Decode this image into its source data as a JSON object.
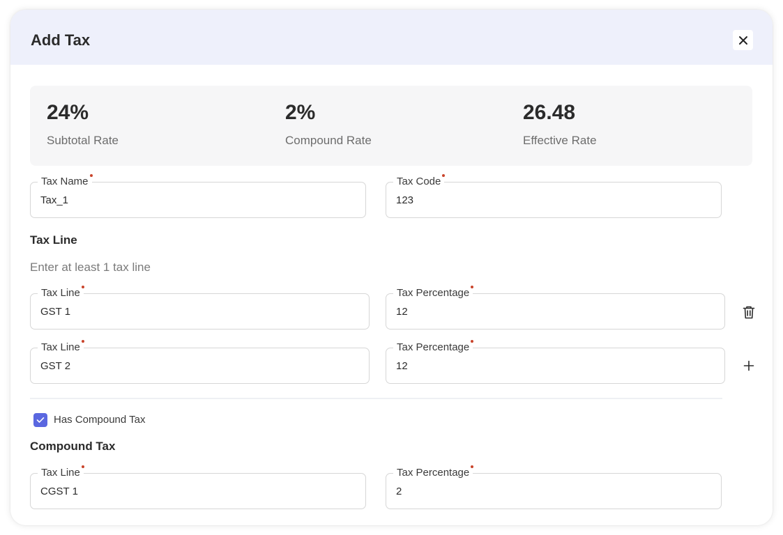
{
  "modal": {
    "title": "Add Tax"
  },
  "summary": {
    "subtotal": {
      "value": "24%",
      "label": "Subtotal Rate"
    },
    "compound": {
      "value": "2%",
      "label": "Compound Rate"
    },
    "effective": {
      "value": "26.48",
      "label": "Effective Rate"
    }
  },
  "tax_name": {
    "label": "Tax Name",
    "value": "Tax_1"
  },
  "tax_code": {
    "label": "Tax Code",
    "value": "123"
  },
  "tax_line_section": {
    "title": "Tax Line",
    "hint": "Enter at least 1 tax line",
    "rows": [
      {
        "line_label": "Tax Line",
        "line_value": "GST 1",
        "pct_label": "Tax Percentage",
        "pct_value": "12"
      },
      {
        "line_label": "Tax Line",
        "line_value": "GST 2",
        "pct_label": "Tax Percentage",
        "pct_value": "12"
      }
    ]
  },
  "compound_toggle": {
    "label": "Has Compound Tax",
    "checked": true
  },
  "compound_section": {
    "title": "Compound Tax",
    "rows": [
      {
        "line_label": "Tax Line",
        "line_value": "CGST 1",
        "pct_label": "Tax Percentage",
        "pct_value": "2"
      }
    ]
  },
  "icons": {
    "close": "close-icon",
    "delete": "trash-icon",
    "add": "plus-icon",
    "check": "check-icon"
  },
  "colors": {
    "header_bg": "#eef0fb",
    "accent": "#5a67e0",
    "required": "#c9442c"
  }
}
